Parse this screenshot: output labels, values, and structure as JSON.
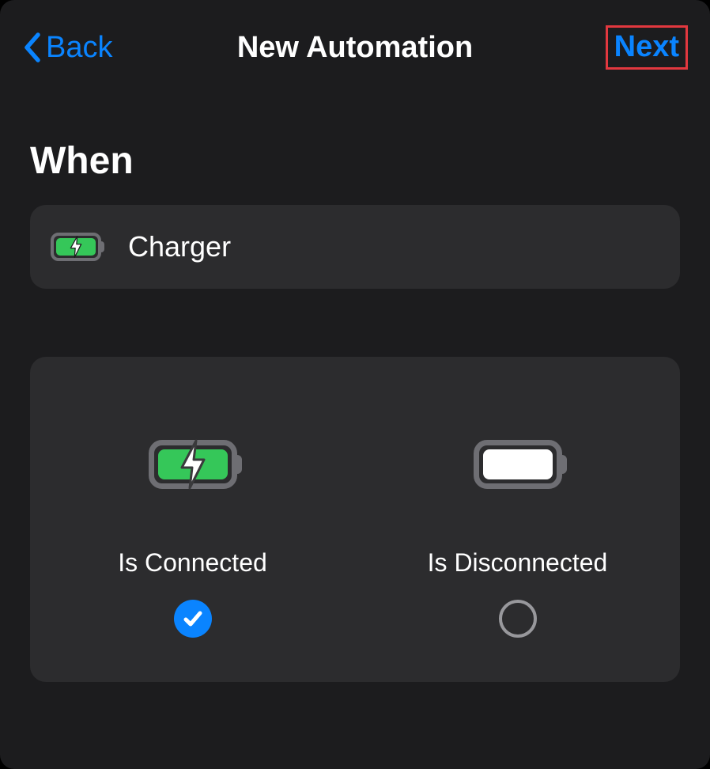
{
  "navbar": {
    "back": "Back",
    "title": "New Automation",
    "next": "Next"
  },
  "section": {
    "heading": "When"
  },
  "trigger": {
    "label": "Charger"
  },
  "options": {
    "connected": {
      "label": "Is Connected",
      "selected": true
    },
    "disconnected": {
      "label": "Is Disconnected",
      "selected": false
    }
  }
}
